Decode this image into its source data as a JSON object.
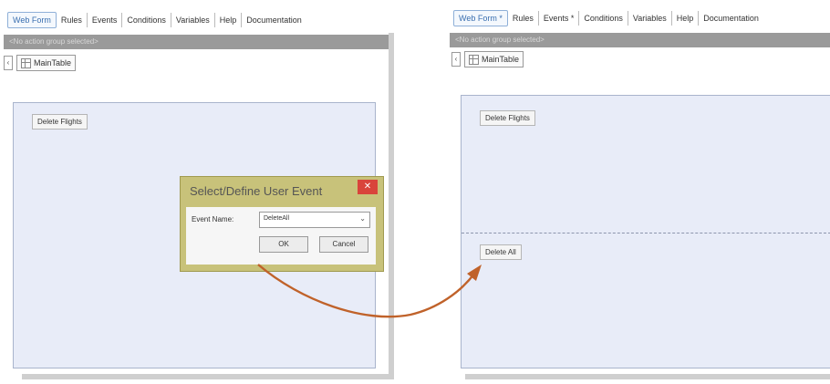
{
  "left": {
    "tabs": [
      {
        "label": "Web Form"
      },
      {
        "label": "Rules"
      },
      {
        "label": "Events"
      },
      {
        "label": "Conditions"
      },
      {
        "label": "Variables"
      },
      {
        "label": "Help"
      },
      {
        "label": "Documentation"
      }
    ],
    "action_bar": "<No action group selected>",
    "main_table_label": "MainTable",
    "button_label": "Delete Flights"
  },
  "dialog": {
    "title": "Select/Define User Event",
    "close_glyph": "✕",
    "event_name_label": "Event Name:",
    "event_name_value": "DeleteAll",
    "ok_label": "OK",
    "cancel_label": "Cancel"
  },
  "right": {
    "tabs": [
      {
        "label": "Web Form *"
      },
      {
        "label": "Rules"
      },
      {
        "label": "Events *"
      },
      {
        "label": "Conditions"
      },
      {
        "label": "Variables"
      },
      {
        "label": "Help"
      },
      {
        "label": "Documentation"
      }
    ],
    "action_bar": "<No action group selected>",
    "main_table_label": "MainTable",
    "button1_label": "Delete Flights",
    "button2_label": "Delete All"
  },
  "icons": {
    "collapse": "‹",
    "chevron": "⌄",
    "table": "grid-icon"
  },
  "colors": {
    "canvas": "#e8ecf8",
    "dialog_frame": "#c8c27a",
    "close_button": "#d9443b",
    "arrow": "#c0622a",
    "active_tab": "#3a6fb0"
  }
}
